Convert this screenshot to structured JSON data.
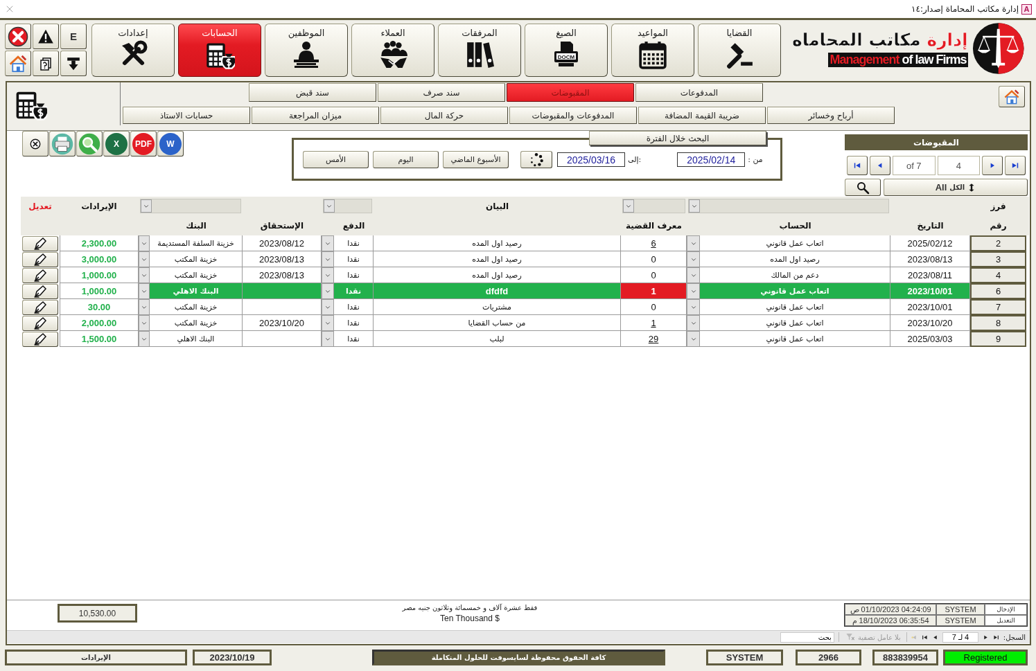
{
  "window": {
    "title": "إدارة مكاتب المحاماة إصدار:١٤",
    "app_icon": "A"
  },
  "quick_buttons": [
    {
      "kind": "letter",
      "label": "E"
    },
    {
      "kind": "warning"
    },
    {
      "kind": "close"
    },
    {
      "kind": "download"
    },
    {
      "kind": "help"
    },
    {
      "kind": "home"
    }
  ],
  "modules": [
    {
      "label": "القضايا",
      "kind": "cases",
      "selected": false
    },
    {
      "label": "المواعيد",
      "kind": "calendar",
      "selected": false
    },
    {
      "label": "الصيغ",
      "kind": "templates",
      "selected": false,
      "badge": "DOCM"
    },
    {
      "label": "المرفقات",
      "kind": "attachments",
      "selected": false
    },
    {
      "label": "العملاء",
      "kind": "clients",
      "selected": false
    },
    {
      "label": "الموظفين",
      "kind": "staff",
      "selected": false
    },
    {
      "label": "الحسابات",
      "kind": "accounts",
      "selected": true
    },
    {
      "label": "إعدادات",
      "kind": "tools",
      "selected": false
    }
  ],
  "logo": {
    "title": [
      "إدارة",
      "مكاتب المحاماه"
    ],
    "subtitle": {
      "highlight": "Management",
      "rest": "of law Firms"
    }
  },
  "sub_tabs": [
    {
      "label": "المدفوعات",
      "selected": false
    },
    {
      "label": "المقبوضات",
      "selected": true
    },
    {
      "label": "سند صرف",
      "selected": false
    },
    {
      "label": "سند قبض",
      "selected": false
    }
  ],
  "reports": [
    "أرباح وخسائر",
    "ضريبة القيمة المضافة",
    "المدفوعات والمقبوضات",
    "حركة المال",
    "ميزان المراجعة",
    "حسابات الاستاذ"
  ],
  "export_buttons": [
    {
      "kind": "word",
      "label": "W"
    },
    {
      "kind": "pdf",
      "label": "PDF"
    },
    {
      "kind": "excel",
      "label": "X"
    },
    {
      "kind": "search"
    },
    {
      "kind": "print"
    },
    {
      "kind": "close"
    }
  ],
  "period": {
    "title": "البحث خلال الفترة",
    "quick": [
      "الأسبوع الماضي",
      "اليوم",
      "الأمس"
    ],
    "to_label": "إلى:",
    "to": "2025/03/16",
    "from_label": "من :",
    "from": "2025/02/14"
  },
  "record_panel": {
    "title": "المقبوضات",
    "total": "of 7",
    "current": "4",
    "all_label": "الكل",
    "all_en": "All"
  },
  "headers": {
    "edit": "تعديل",
    "revenue": "الإيرادات",
    "statement": "البيان",
    "sort": "فرز",
    "bank": "البنك",
    "due": "الإستحقاق",
    "payment": "الدفع",
    "case_id": "معرف القضية",
    "account": "الحساب",
    "date": "التاريخ",
    "number": "رقم"
  },
  "rows": [
    {
      "number": "2",
      "date": "2025/02/12",
      "account": "اتعاب عمل قانوني",
      "case_id": "6",
      "case_linked": true,
      "statement": "رصيد اول المده",
      "payment": "نقدا",
      "due": "2023/08/12",
      "bank": "خزينة السلفة المستديمة",
      "revenue": "2,300.00",
      "selected": false
    },
    {
      "number": "3",
      "date": "2023/08/13",
      "account": "رصيد اول المده",
      "case_id": "0",
      "case_linked": false,
      "statement": "رصيد اول المده",
      "payment": "نقدا",
      "due": "2023/08/13",
      "bank": "خزينة المكتب",
      "revenue": "3,000.00",
      "selected": false
    },
    {
      "number": "4",
      "date": "2023/08/11",
      "account": "دعم من المالك",
      "case_id": "0",
      "case_linked": false,
      "statement": "رصيد اول المده",
      "payment": "نقدا",
      "due": "2023/08/13",
      "bank": "خزينة المكتب",
      "revenue": "1,000.00",
      "selected": false
    },
    {
      "number": "6",
      "date": "2023/10/01",
      "account": "اتعاب عمل قانوني",
      "case_id": "1",
      "case_linked": false,
      "statement": "dfdfd",
      "payment": "نقدا",
      "bank": "البنك الاهلي",
      "revenue": "1,000.00",
      "selected": true
    },
    {
      "number": "7",
      "date": "2023/10/01",
      "account": "اتعاب عمل قانوني",
      "case_id": "0",
      "case_linked": false,
      "statement": "مشتريات",
      "payment": "نقدا",
      "bank": "خزينة المكتب",
      "revenue": "30.00",
      "selected": false
    },
    {
      "number": "8",
      "date": "2023/10/20",
      "account": "اتعاب عمل قانوني",
      "case_id": "1",
      "case_linked": true,
      "statement": "من حساب القضايا",
      "payment": "نقدا",
      "due": "2023/10/20",
      "bank": "خزينة المكتب",
      "revenue": "2,000.00",
      "selected": false
    },
    {
      "number": "9",
      "date": "2025/03/03",
      "account": "اتعاب عمل قانوني",
      "case_id": "29",
      "case_linked": true,
      "statement": "لبلب",
      "payment": "نقدا",
      "bank": "البنك الاهلي",
      "revenue": "1,500.00",
      "selected": false
    }
  ],
  "footer": {
    "total": "10,530.00",
    "amount_words_ar": "فقط عشرة آلاف و خمسمائة وثلاثون جنيه مصر",
    "amount_words_en": "Ten Thousand $",
    "audit": [
      {
        "label": "الإدخال",
        "user": "SYSTEM",
        "time": "04:24:09 01/10/2023 ص"
      },
      {
        "label": "التعديل",
        "user": "SYSTEM",
        "time": "06:35:54 18/10/2023 م"
      }
    ]
  },
  "record_nav": {
    "label": "السجل:",
    "position": "4 لـ 7",
    "filter": "بلا عامل تصفية",
    "search": "بحث"
  },
  "status_bar": {
    "label": "الإيرادات",
    "date": "2023/10/19",
    "copyright": "كافة الحقوق محفوظة لسايسوفت للحلول المتكاملة",
    "user": "SYSTEM",
    "code": "2966",
    "serial": "883839954",
    "registration": "Registered",
    "registered": true
  }
}
